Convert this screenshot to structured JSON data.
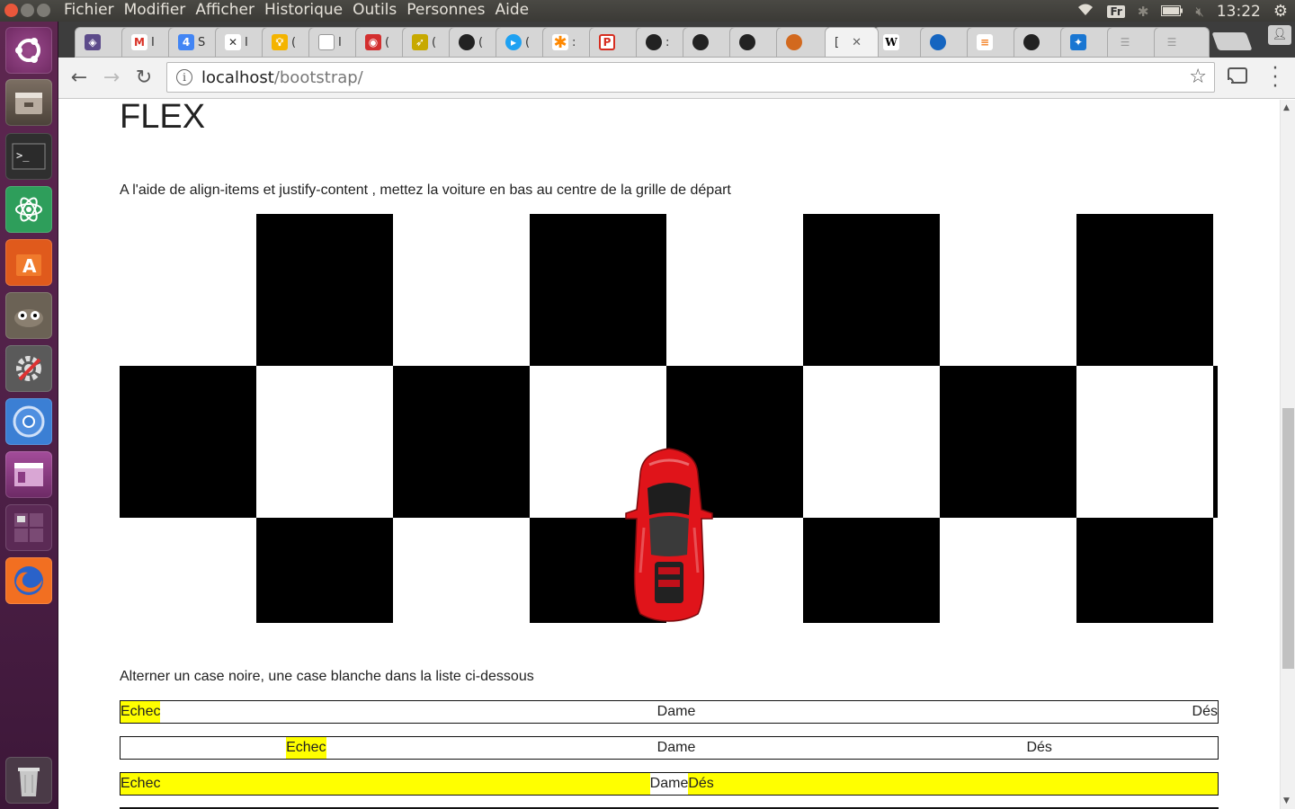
{
  "system_bar": {
    "menus": [
      "Fichier",
      "Modifier",
      "Afficher",
      "Historique",
      "Outils",
      "Personnes",
      "Aide"
    ],
    "keyboard_layout": "Fr",
    "clock": "13:22"
  },
  "launcher": {
    "items": [
      "ubuntu-dash",
      "files",
      "terminal",
      "atom",
      "software-center",
      "gimp",
      "system-settings",
      "chromium",
      "window-manager",
      "workspaces",
      "firefox",
      "trash"
    ]
  },
  "browser": {
    "tabs": [
      {
        "icon": "extension-icon",
        "label": "",
        "color": "#5c4b8a"
      },
      {
        "icon": "gmail-icon",
        "label": "I",
        "color": "#d93025"
      },
      {
        "icon": "calendar-icon",
        "label": "S",
        "color": "#4285f4"
      },
      {
        "icon": "x-icon",
        "label": "I",
        "color": "#333333"
      },
      {
        "icon": "bulb-icon",
        "label": "(",
        "color": "#f4b400"
      },
      {
        "icon": "page-icon",
        "label": "I",
        "color": "#777777"
      },
      {
        "icon": "rss-icon",
        "label": "(",
        "color": "#d32f2f"
      },
      {
        "icon": "rocket-icon",
        "label": "(",
        "color": "#c7a900"
      },
      {
        "icon": "github-icon",
        "label": "(",
        "color": "#222222"
      },
      {
        "icon": "play-icon",
        "label": "(",
        "color": "#1ea1f2"
      },
      {
        "icon": "asterisk-icon",
        "label": ":",
        "color": "#ff8800"
      },
      {
        "icon": "p-icon",
        "label": "",
        "color": "#d62d20"
      },
      {
        "icon": "github-icon",
        "label": ":",
        "color": "#222222"
      },
      {
        "icon": "github-icon",
        "label": "",
        "color": "#222222"
      },
      {
        "icon": "github-icon",
        "label": "",
        "color": "#222222"
      },
      {
        "icon": "cookie-icon",
        "label": "",
        "color": "#d2691e"
      },
      {
        "icon": "none",
        "label": "[",
        "color": "#ffffff",
        "active": true
      },
      {
        "icon": "wikipedia-icon",
        "label": "",
        "color": "#ffffff"
      },
      {
        "icon": "apk-icon",
        "label": "",
        "color": "#1565c0"
      },
      {
        "icon": "stackoverflow-icon",
        "label": "",
        "color": "#f48024"
      },
      {
        "icon": "github-icon",
        "label": "",
        "color": "#222222"
      },
      {
        "icon": "ribbon-icon",
        "label": "",
        "color": "#1976d2"
      },
      {
        "icon": "lines-icon",
        "label": "",
        "color": "#999999"
      },
      {
        "icon": "lines-icon",
        "label": "",
        "color": "#999999"
      }
    ],
    "url_host": "localhost",
    "url_path": "/bootstrap/"
  },
  "page": {
    "heading": "FLEX",
    "instruction_1": "A l'aide de align-items et justify-content , mettez la voiture en bas au centre de la grille de départ",
    "instruction_2": "Alterner un case noire, une case blanche dans la liste ci-dessous",
    "rows": [
      {
        "items": [
          "Echec",
          "Dame",
          "Dés"
        ]
      },
      {
        "items": [
          "Echec",
          "Dame",
          "Dés"
        ]
      },
      {
        "items": [
          "Echec",
          "Dame",
          "Dés"
        ]
      }
    ]
  },
  "colors": {
    "checker_black": "#000000",
    "highlight": "#ffff00",
    "car_red": "#e0141a"
  }
}
